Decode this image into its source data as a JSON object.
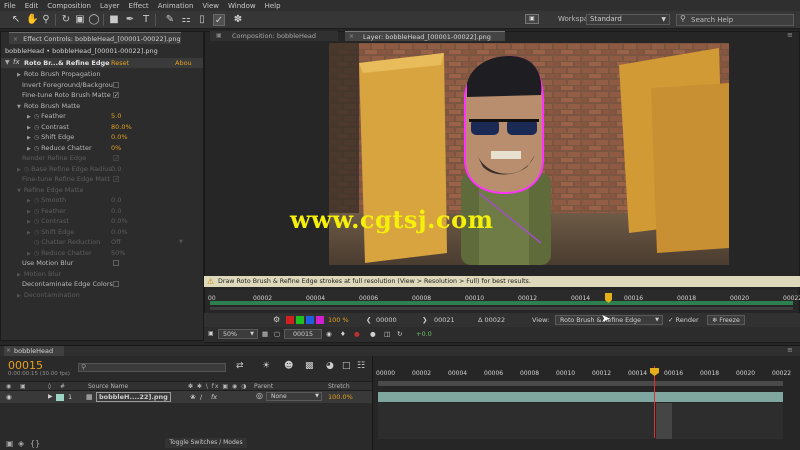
{
  "menu": [
    "File",
    "Edit",
    "Composition",
    "Layer",
    "Effect",
    "Animation",
    "View",
    "Window",
    "Help"
  ],
  "toolbar": {
    "workspace_label": "Workspace:",
    "workspace_value": "Standard",
    "search_placeholder": "Search Help"
  },
  "effect_controls": {
    "tab_label": "Effect Controls: bobbleHead_[00001-00022].png",
    "subtitle": "bobbleHead • bobbleHead_[00001-00022].png",
    "effect_name": "Roto Br...& Refine Edge",
    "reset_label": "Reset",
    "about_label": "Abou",
    "rows": [
      {
        "label": "Roto Brush Propagation",
        "value": ""
      },
      {
        "label": "Invert Foreground/Backgrou",
        "value": ""
      },
      {
        "label": "Fine-tune Roto Brush Matte",
        "value": ""
      },
      {
        "label": "Roto Brush Matte",
        "value": ""
      },
      {
        "label": "Feather",
        "value": "5.0"
      },
      {
        "label": "Contrast",
        "value": "80.0%"
      },
      {
        "label": "Shift Edge",
        "value": "0.0%"
      },
      {
        "label": "Reduce Chatter",
        "value": "0%"
      },
      {
        "label": "Render Refine Edge",
        "value": ""
      },
      {
        "label": "Base Refine Edge Radius",
        "value": "0.0"
      },
      {
        "label": "Fine-tune Refine Edge Matt",
        "value": ""
      },
      {
        "label": "Refine Edge Matte",
        "value": ""
      },
      {
        "label": "Smooth",
        "value": "0.0"
      },
      {
        "label": "Feather",
        "value": "0.0"
      },
      {
        "label": "Contrast",
        "value": "0.0%"
      },
      {
        "label": "Shift Edge",
        "value": "0.0%"
      },
      {
        "label": "Chatter Reduction",
        "value": "Off"
      },
      {
        "label": "Reduce Chatter",
        "value": "50%"
      },
      {
        "label": "Use Motion Blur",
        "value": ""
      },
      {
        "label": "Motion Blur",
        "value": ""
      },
      {
        "label": "Decontaminate Edge Colors",
        "value": ""
      },
      {
        "label": "Decontamination",
        "value": ""
      }
    ]
  },
  "viewer": {
    "comp_tab": "Composition: bobbleHead",
    "layer_tab": "Layer: bobbleHead_[00001-00022].png",
    "watermark": "www.cgtsj.com",
    "warning": "Draw Roto Brush & Refine Edge strokes at full resolution (View > Resolution > Full) for best results.",
    "ruler_labels": [
      "00",
      "00002",
      "00004",
      "00006",
      "00008",
      "00010",
      "00012",
      "00014",
      "00016",
      "00018",
      "00020",
      "00022"
    ],
    "zoom_percent": "100 %",
    "start_frame": "00000",
    "end_frame": "00021",
    "duration": "Δ 00022",
    "view_label": "View:",
    "view_value": "Roto Brush & Refine Edge",
    "render_label": "Render",
    "freeze_label": "Freeze",
    "magnification": "50%",
    "current_frame": "00015",
    "exposure": "+0.0",
    "channel_colors": [
      "#d02020",
      "#20c020",
      "#2060e0",
      "#d020d0"
    ]
  },
  "timeline": {
    "tab_label": "bobbleHead",
    "timecode": "00015",
    "timecode_sub": "0:00:00:15 (30.00 fps)",
    "search_placeholder": "",
    "columns": [
      "Source Name",
      "Parent",
      "Stretch"
    ],
    "layer": {
      "index": "1",
      "name": "bobbleH....22].png",
      "parent": "None",
      "stretch": "100.0%"
    },
    "ruler_labels": [
      "00000",
      "00002",
      "00004",
      "00006",
      "00008",
      "00010",
      "00012",
      "00014",
      "00016",
      "00018",
      "00020",
      "00022"
    ],
    "toggle_label": "Toggle Switches / Modes"
  }
}
